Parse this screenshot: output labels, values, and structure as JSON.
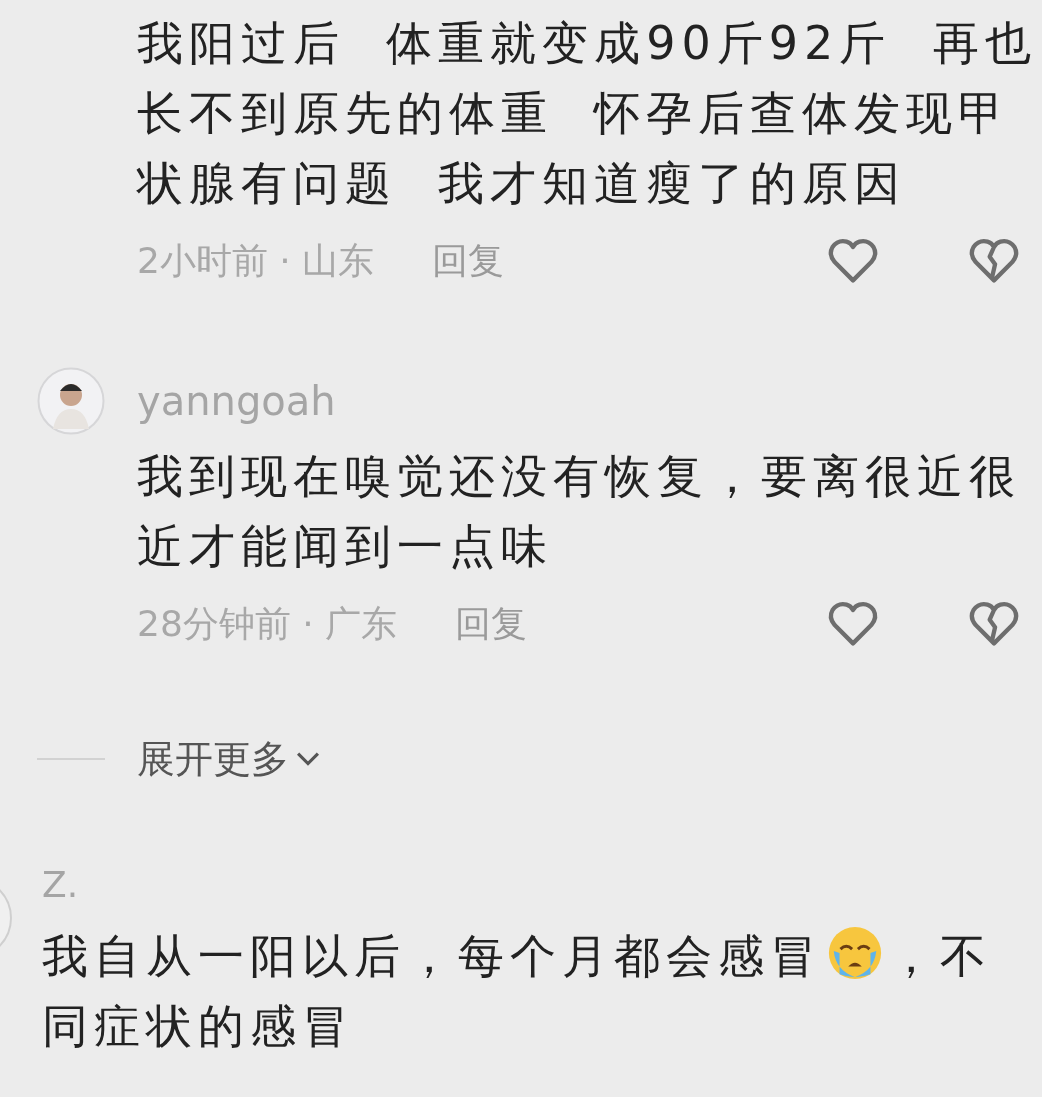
{
  "comments": [
    {
      "text": "我阳过后  体重就变成90斤92斤  再也长不到原先的体重  怀孕后查体发现甲状腺有问题  我才知道瘦了的原因",
      "meta": "2小时前 · 山东",
      "reply_label": "回复"
    },
    {
      "avatar": true,
      "author": "yanngoah",
      "text": "我到现在嗅觉还没有恢复，要离很近很近才能闻到一点味",
      "meta": "28分钟前 · 广东",
      "reply_label": "回复"
    }
  ],
  "expand": {
    "label": "展开更多"
  },
  "next_comment": {
    "author": "Z.",
    "line_1_before_emoji": "我自从一阳以后，每个月都会感冒",
    "line_1_after_emoji": "，不",
    "line_2": "同症状的感冒"
  }
}
